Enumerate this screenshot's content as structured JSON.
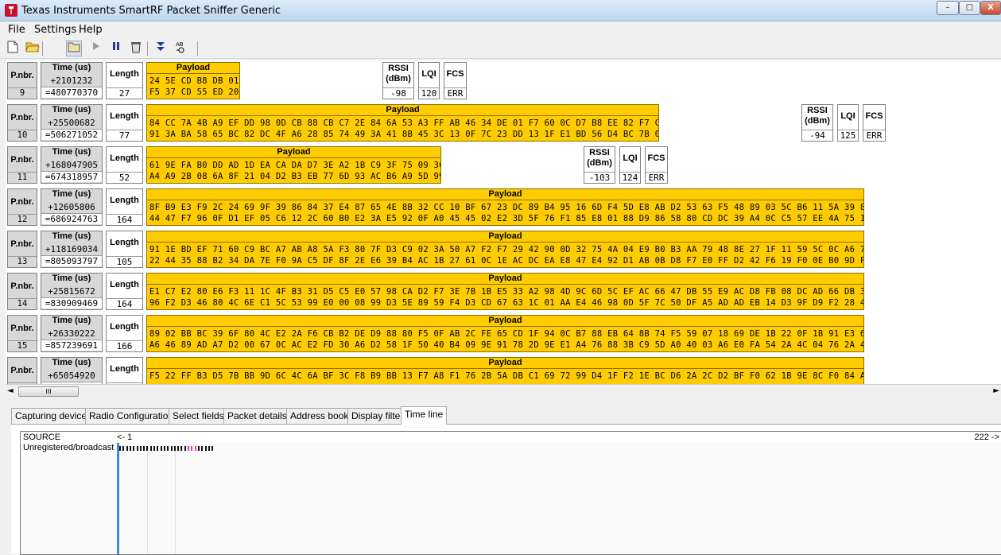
{
  "window": {
    "title": "Texas Instruments SmartRF Packet Sniffer Generic",
    "minimize": "–",
    "maximize": "□",
    "close": "X"
  },
  "menu": [
    "File",
    "Settings",
    "Help"
  ],
  "toolbar": {
    "icons": [
      "new-icon",
      "open-icon",
      "open-folder-icon",
      "play-icon",
      "pause-icon",
      "clear-icon",
      "autoscroll-icon",
      "address-resolve-icon"
    ]
  },
  "headers": {
    "pnbr": "P.nbr.",
    "time": "Time (us)",
    "length": "Length",
    "payload": "Payload",
    "rssi": "RSSI (dBm)",
    "lqi": "LQI",
    "fcs": "FCS"
  },
  "packets": [
    {
      "nbr": "9",
      "t_rel": "+2101232",
      "t_abs": "=480770370",
      "len": "27",
      "l1": "24 5E CD B8 DB 01 6F F6 A6 C7 8E 4A 63 3F",
      "l2": "F5 37 CD 55 ED 20 FC 48 29 52 8F 9F 16",
      "rssi": "-98",
      "lqi": "120",
      "fcs": "ERR"
    },
    {
      "nbr": "10",
      "t_rel": "+25500682",
      "t_abs": "=506271052",
      "len": "77",
      "l1": "84 CC 7A 4B A9 EF DD 98 0D CB 88 CB C7 2E 84 6A 53 A3 FF AB 46 34 DE 01 F7 60 0C D7 B8 EE 82 F7 C3 7C 2F D0 C1 02 C7",
      "l2": "91 3A BA 58 65 BC 82 DC 4F A6 28 85 74 49 3A 41 8B 45 3C 13 0F 7C 23 DD 13 1F E1 BD 56 D4 BC 7B 0C B2 81 27 DC 6D",
      "rssi": "-94",
      "lqi": "125",
      "fcs": "ERR"
    },
    {
      "nbr": "11",
      "t_rel": "+168047905",
      "t_abs": "=674318957",
      "len": "52",
      "l1": "61 9E FA B0 DD AD 1D EA CA DA D7 3E A2 1B C9 3F 75 09 3C 19 EE FE A2 F9 D7 31",
      "l2": "A4 A9 2B 08 6A 8F 21 04 D2 B3 EB 77 6D 93 AC B6 A9 5D 99 9A 65 AF 77 2E 27 04",
      "rssi": "-103",
      "lqi": "124",
      "fcs": "ERR"
    },
    {
      "nbr": "12",
      "t_rel": "+12605806",
      "t_abs": "=686924763",
      "len": "164",
      "l1": "8F B9 E3 F9 2C 24 69 9F 39 86 84 37 E4 87 65 4E 8B 32 CC 10 BF 67 23 DC 89 B4 95 16 6D F4 5D E8 AB D2 53 63 F5 48 89 03 5C B6 11 5A 39 88 07 33 1B 6B 34",
      "l2": "44 47 F7 96 0F D1 EF 05 C6 12 2C 60 B0 E2 3A E5 92 0F A0 45 45 02 E2 3D 5F 76 F1 85 E8 01 88 D9 86 58 80 CD DC 39 A4 0C C5 57 EE 4A 75 10 E0 AE 92 E8 36"
    },
    {
      "nbr": "13",
      "t_rel": "+118169034",
      "t_abs": "=805093797",
      "len": "105",
      "l1": "91 1E BD EF 71 60 C9 BC A7 AB A8 5A F3 80 7F D3 C9 02 3A 50 A7 F2 F7 29 42 90 0D 32 75 4A 04 E9 B0 B3 AA 79 48 8E 27 1F 11 59 5C 0C A6 7E ED CC 72 5F 06",
      "l2": "22 44 35 88 B2 34 DA 7E F0 9A C5 DF 8F 2E E6 39 B4 AC 1B 27 61 0C 1E AC DC EA E8 47 E4 92 D1 AB 0B D8 F7 E0 FF D2 42 F6 19 F0 0E B0 9D FE FB DC 4D DF E7"
    },
    {
      "nbr": "14",
      "t_rel": "+25815672",
      "t_abs": "=830909469",
      "len": "164",
      "l1": "E1 C7 E2 80 E6 F3 11 1C 4F B3 31 D5 C5 E0 57 98 CA D2 F7 3E 7B 1B E5 33 A2 98 4D 9C 6D 5C EF AC 66 47 DB 55 E9 AC D8 FB 08 DC AD 66 DB 38 54 93 04 1A BD",
      "l2": "96 F2 D3 46 80 4C 6E C1 5C 53 99 E0 00 08 99 D3 5E 89 59 F4 D3 CD 67 63 1C 01 AA E4 46 98 0D 5F 7C 50 DF A5 AD AD EB 14 D3 9F D9 F2 28 4D 34 89 B6 3D 0E"
    },
    {
      "nbr": "15",
      "t_rel": "+26330222",
      "t_abs": "=857239691",
      "len": "166",
      "l1": "89 02 BB BC 39 6F 80 4C E2 2A F6 CB B2 DE D9 88 80 F5 0F AB 2C FE 65 CD 1F 94 0C B7 88 EB 64 8B 74 F5 59 07 18 69 DE 1B 22 0F 1B 91 E3 65 BC D4 D4 58 84",
      "l2": "A6 46 89 AD A7 D2 00 67 0C AC E2 FD 30 A6 D2 58 1F 50 40 B4 09 9E 91 78 2D 9E E1 A4 76 88 3B C9 5D A0 40 03 A6 E0 FA 54 2A 4C 04 76 2A 4C BA AB A8 A1 F9"
    },
    {
      "nbr": "16",
      "t_rel": "+65054920",
      "t_abs": "",
      "len": "",
      "l1": "F5 22 FF B3 D5 7B BB 9D 6C 4C 6A BF 3C F8 B9 BB 13 F7 A8 F1 76 2B 5A DB C1 69 72 99 D4 1F F2 1E BC D6 2A 2C D2 BF F0 62 1B 9E 8C F0 84 A4 0E C5 EE 4F F7",
      "l2": ""
    }
  ],
  "scrollbar": {
    "thumb": "III",
    "left": "◄",
    "right": "►"
  },
  "tabs": [
    "Capturing device",
    "Radio Configuration",
    "Select fields",
    "Packet details",
    "Address book",
    "Display filter",
    "Time line"
  ],
  "active_tab": "Time line",
  "timeline": {
    "source_label": "SOURCE",
    "start": "<- 1",
    "end": "222 ->",
    "row_label": "Unregistered/broadcast"
  }
}
